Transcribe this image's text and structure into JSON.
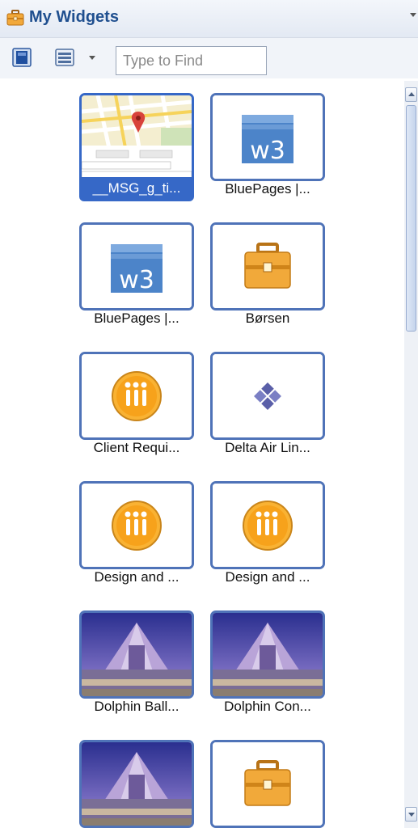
{
  "header": {
    "title": "My Widgets",
    "icon": "toolbox-icon"
  },
  "toolbar": {
    "single_view_icon": "single-view-icon",
    "list_view_icon": "list-view-icon",
    "search_placeholder": "Type to Find"
  },
  "widgets": [
    {
      "label": "__MSG_g_ti...",
      "icon": "map-thumbnail-icon",
      "selected": true
    },
    {
      "label": "BluePages |...",
      "icon": "w3-icon"
    },
    {
      "label": "BluePages |...",
      "icon": "w3-icon"
    },
    {
      "label": "Børsen",
      "icon": "toolbox-icon"
    },
    {
      "label": "Client Requi...",
      "icon": "lotus-notes-icon"
    },
    {
      "label": "Delta Air Lin...",
      "icon": "delta-diamond-icon"
    },
    {
      "label": "Design and ...",
      "icon": "lotus-notes-icon"
    },
    {
      "label": "Design and ...",
      "icon": "lotus-notes-icon"
    },
    {
      "label": "Dolphin Ball...",
      "icon": "dolphin-hotel-photo-icon"
    },
    {
      "label": "Dolphin Con...",
      "icon": "dolphin-hotel-photo-icon"
    },
    {
      "label": "",
      "icon": "dolphin-hotel-photo-icon"
    },
    {
      "label": "",
      "icon": "toolbox-icon"
    }
  ],
  "colors": {
    "accent": "#3668c7",
    "tile_border": "#4f73b8",
    "title": "#1f4f8f"
  }
}
